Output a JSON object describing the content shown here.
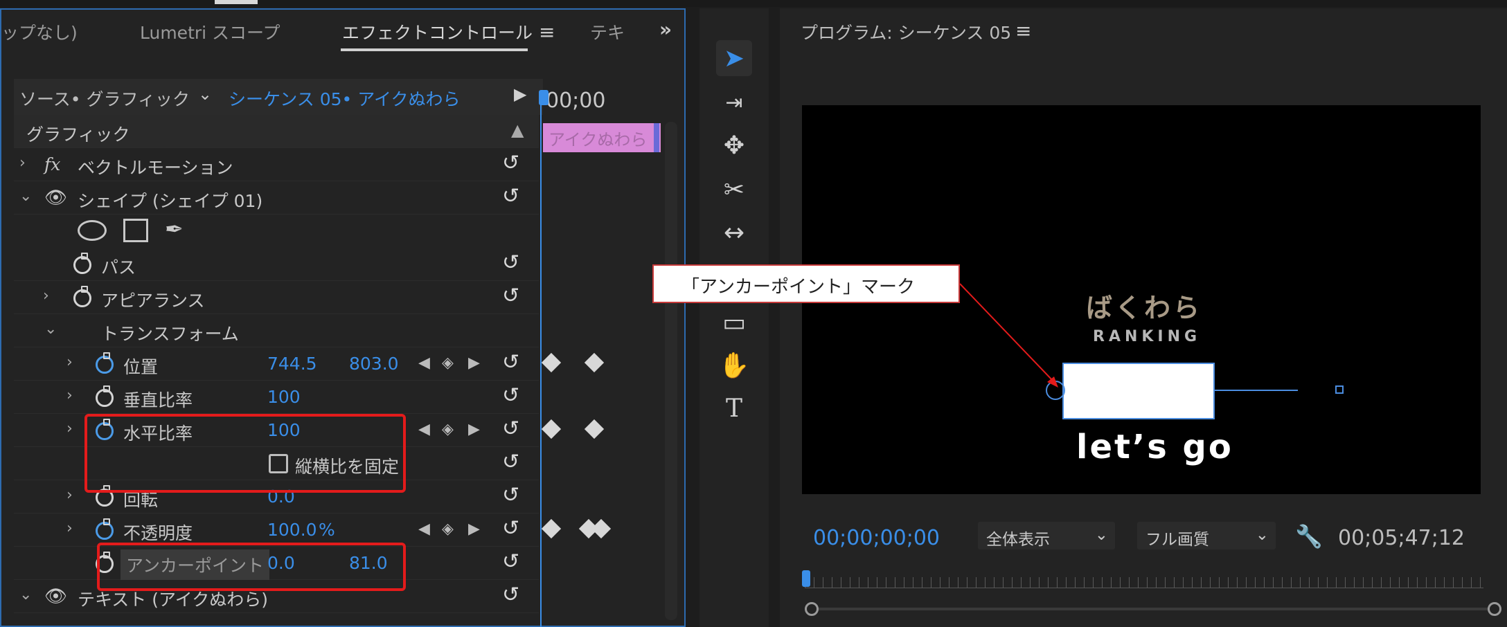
{
  "left_panel": {
    "tabs": [
      "ップなし)",
      "Lumetri スコープ",
      "エフェクトコントロール",
      "テキ"
    ],
    "active_tab": "エフェクトコントロール",
    "source_label": "ソース• グラフィック",
    "sequence_label": "シーケンス 05• アイクぬわら",
    "timecode": "00;00",
    "clip_label": "アイクぬわら",
    "section_title": "グラフィック",
    "rows": {
      "vector_motion": "ベクトルモーション",
      "fx": "fx",
      "shape": "シェイプ (シェイプ 01)",
      "path": "パス",
      "appearance": "アピアランス",
      "transform": "トランスフォーム",
      "position": {
        "label": "位置",
        "x": "744.5",
        "y": "803.0"
      },
      "vertical_scale": {
        "label": "垂直比率",
        "value": "100"
      },
      "horizontal_scale": {
        "label": "水平比率",
        "value": "100"
      },
      "lock_aspect": "縦横比を固定",
      "rotation": {
        "label": "回転",
        "value": "0.0"
      },
      "opacity": {
        "label": "不透明度",
        "value": "100.0",
        "unit": "%"
      },
      "anchor": {
        "label": "アンカーポイント",
        "x": "0.0",
        "y": "81.0"
      },
      "text_layer": "テキスト (アイクぬわら)"
    }
  },
  "tools": [
    "selection-tool",
    "track-select-tool",
    "ripple-edit-tool",
    "razor-tool",
    "slip-tool",
    "rectangle-tool",
    "hand-tool",
    "type-tool"
  ],
  "program": {
    "title": "プログラム: シーケンス 05",
    "video_text_top": "ばくわら",
    "video_text_sub": "RANKING",
    "video_text_bottom": "let’s go",
    "current_tc": "00;00;00;00",
    "fit_select": "全体表示",
    "quality_select": "フル画質",
    "duration_tc": "00;05;47;12"
  },
  "callout": "「アンカーポイント」マーク",
  "colors": {
    "accent": "#3a8ee8",
    "annotation": "#e31b1b",
    "clip": "#d88ad8"
  }
}
